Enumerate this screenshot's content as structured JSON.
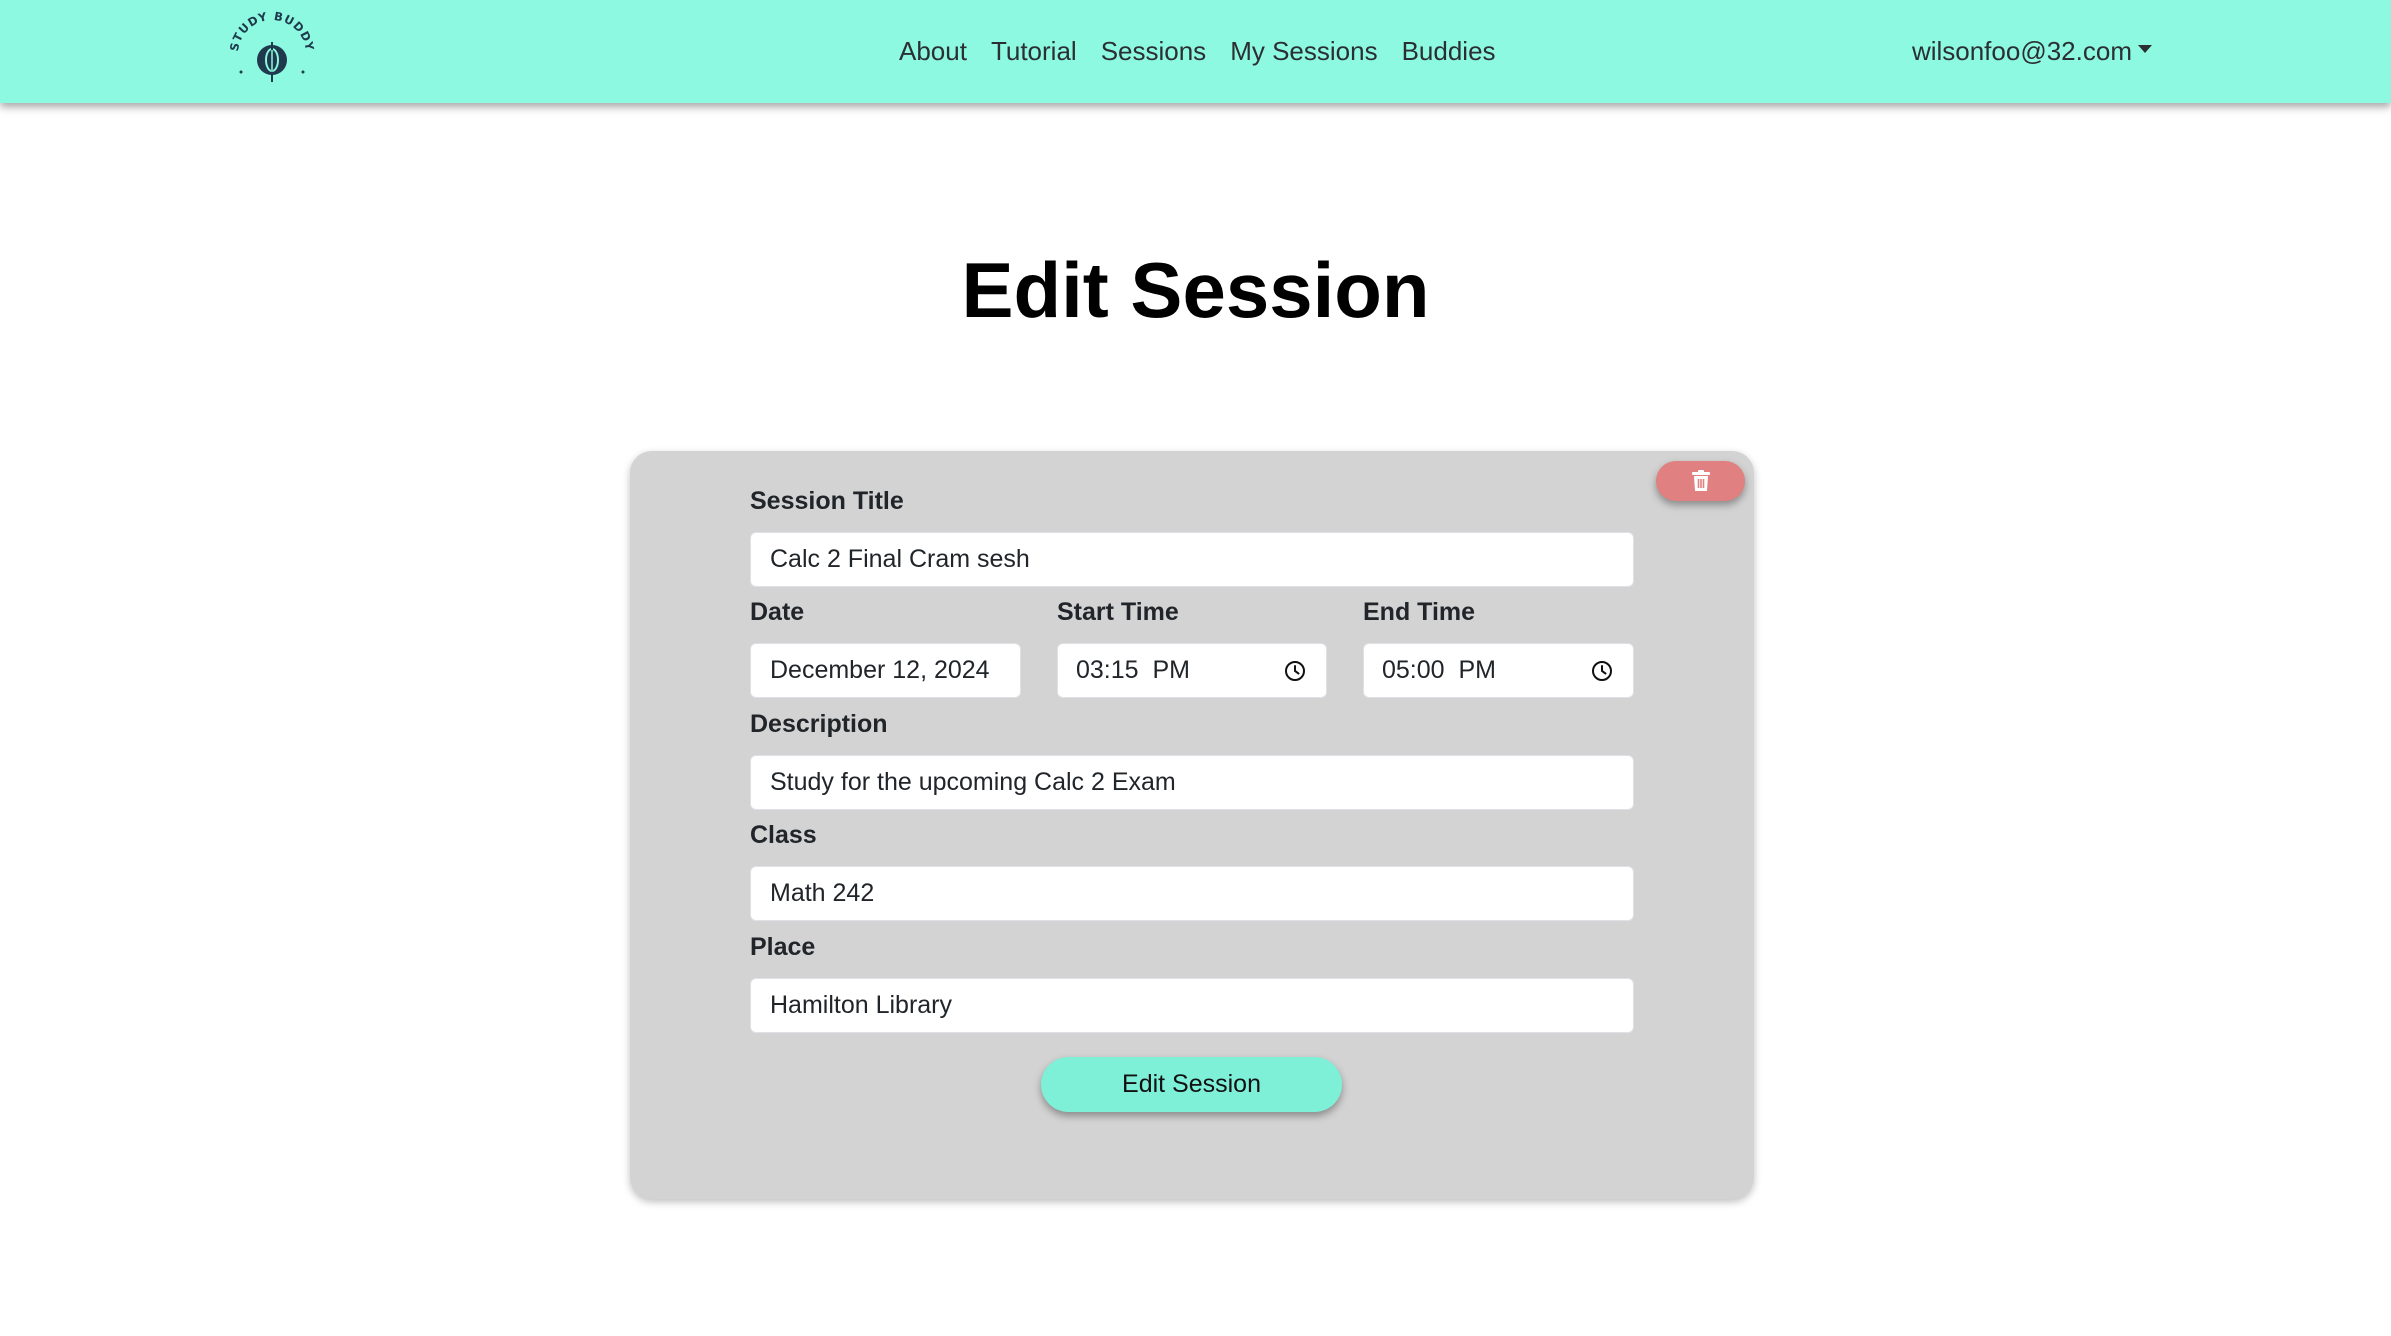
{
  "navbar": {
    "logo_text": "STUDY BUDDY",
    "links": [
      {
        "label": "About"
      },
      {
        "label": "Tutorial"
      },
      {
        "label": "Sessions"
      },
      {
        "label": "My Sessions"
      },
      {
        "label": "Buddies"
      }
    ],
    "user_email": "wilsonfoo@32.com"
  },
  "page": {
    "title": "Edit Session"
  },
  "form": {
    "session_title": {
      "label": "Session Title",
      "value": "Calc 2 Final Cram sesh"
    },
    "date": {
      "label": "Date",
      "value": "December 12, 2024"
    },
    "start_time": {
      "label": "Start Time",
      "value": "03:15  PM"
    },
    "end_time": {
      "label": "End Time",
      "value": "05:00  PM"
    },
    "description": {
      "label": "Description",
      "value": "Study for the upcoming Calc 2 Exam"
    },
    "class": {
      "label": "Class",
      "value": "Math 242"
    },
    "place": {
      "label": "Place",
      "value": "Hamilton Library"
    },
    "submit_label": "Edit Session"
  },
  "colors": {
    "navbar_bg": "#8cf9e0",
    "card_bg": "#d3d3d3",
    "delete_button": "#e08080",
    "submit_button": "#7ff0d8",
    "logo_dark": "#1f3a4d"
  },
  "icons": {
    "delete": "trash-icon",
    "time": "clock-icon",
    "menu": "caret-down-icon"
  }
}
